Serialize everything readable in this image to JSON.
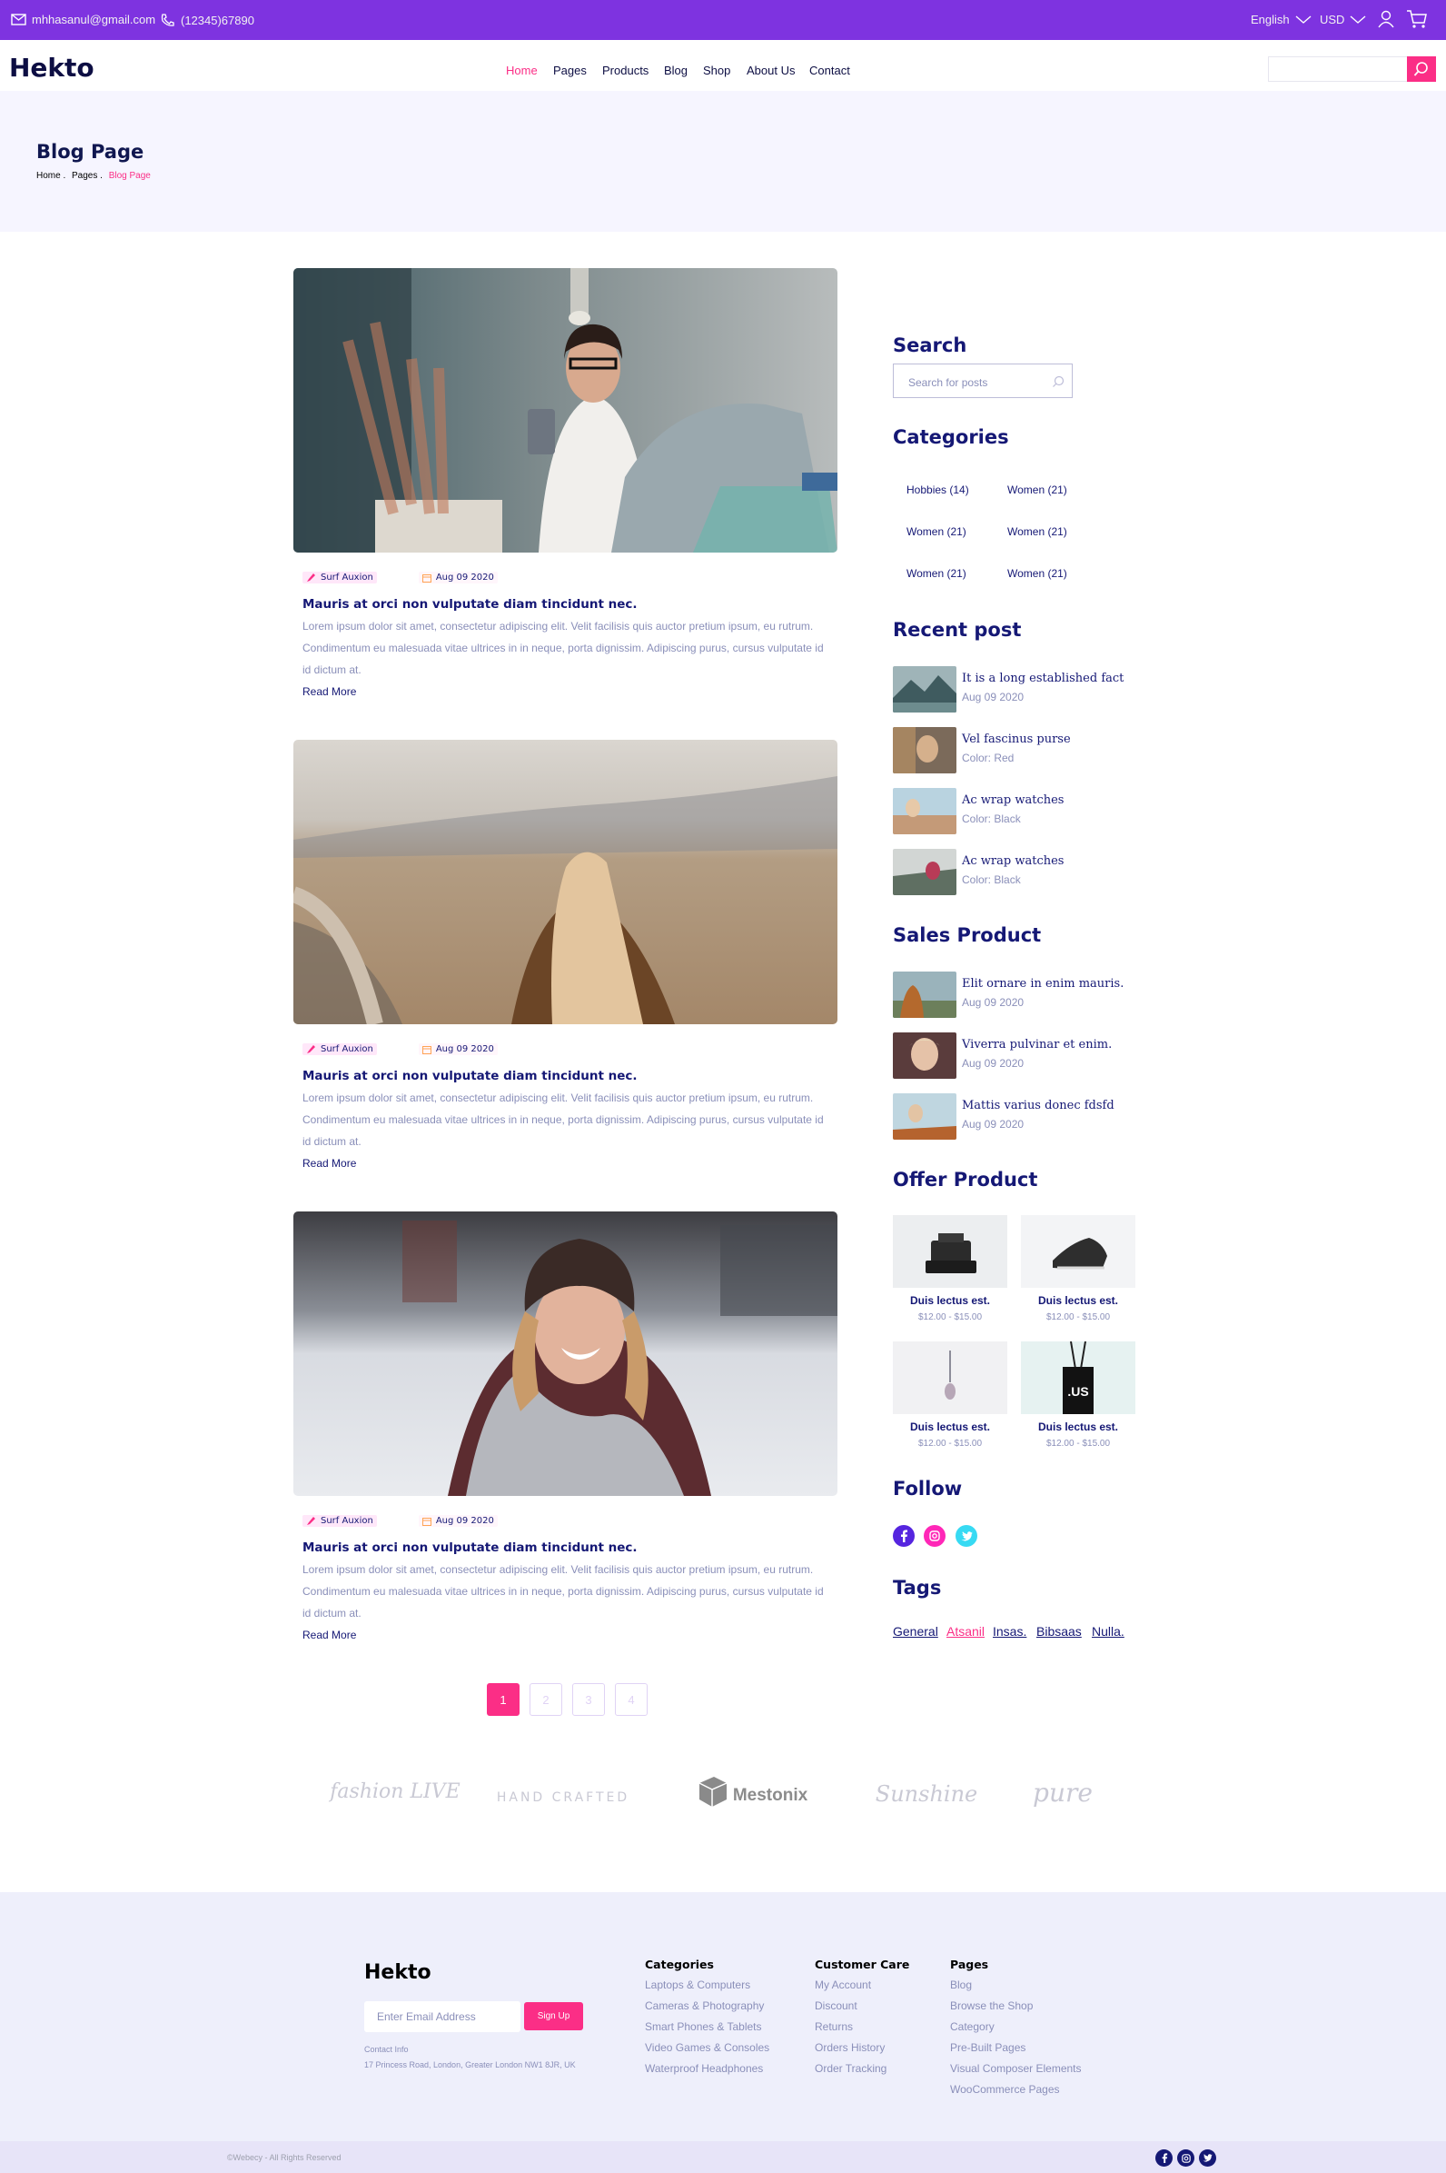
{
  "topbar": {
    "email": "mhhasanul@gmail.com",
    "phone": "(12345)67890",
    "language": "English",
    "currency": "USD"
  },
  "nav": {
    "logo": "Hekto",
    "items": [
      "Home",
      "Pages",
      "Products",
      "Blog",
      "Shop",
      "About Us",
      "Contact"
    ],
    "search_value": ""
  },
  "hero": {
    "title": "Blog Page",
    "crumbs": [
      "Home .",
      "Pages .",
      "Blog Page"
    ]
  },
  "posts": [
    {
      "author": "Surf Auxion",
      "date": "Aug 09 2020",
      "title": "Mauris at orci non vulputate diam tincidunt nec.",
      "line1": "Lorem ipsum dolor sit amet, consectetur adipiscing elit. Velit facilisis quis auctor pretium ipsum, eu rutrum.",
      "line2": "Condimentum eu malesuada vitae ultrices in in neque, porta dignissim. Adipiscing purus, cursus vulputate id",
      "line3": "id dictum at.",
      "read_more": "Read More"
    },
    {
      "author": "Surf Auxion",
      "date": "Aug 09 2020",
      "title": "Mauris at orci non vulputate diam tincidunt nec.",
      "line1": "Lorem ipsum dolor sit amet, consectetur adipiscing elit. Velit facilisis quis auctor pretium ipsum, eu rutrum.",
      "line2": "Condimentum eu malesuada vitae ultrices in in neque, porta dignissim. Adipiscing purus, cursus vulputate id",
      "line3": "id dictum at.",
      "read_more": "Read More"
    },
    {
      "author": "Surf Auxion",
      "date": "Aug 09 2020",
      "title": "Mauris at orci non vulputate diam tincidunt nec.",
      "line1": "Lorem ipsum dolor sit amet, consectetur adipiscing elit. Velit facilisis quis auctor pretium ipsum, eu rutrum.",
      "line2": "Condimentum eu malesuada vitae ultrices in in neque, porta dignissim. Adipiscing purus, cursus vulputate id",
      "line3": "id dictum at.",
      "read_more": "Read More"
    }
  ],
  "pagination": [
    "1",
    "2",
    "3",
    "4"
  ],
  "sidebar": {
    "search_title": "Search",
    "search_placeholder": "Search for posts",
    "categories_title": "Categories",
    "categories": [
      "Hobbies (14)",
      "Women (21)",
      "Women (21)",
      "Women (21)",
      "Women (21)",
      "Women (21)"
    ],
    "recent_title": "Recent post",
    "recent": [
      {
        "title": "It is a long established fact",
        "sub": "Aug 09 2020"
      },
      {
        "title": "Vel fascinus purse",
        "sub": "Color: Red"
      },
      {
        "title": "Ac wrap watches",
        "sub": "Color: Black"
      },
      {
        "title": "Ac wrap watches",
        "sub": "Color: Black"
      }
    ],
    "sales_title": "Sales Product",
    "sales": [
      {
        "title": "Elit ornare in enim mauris.",
        "sub": "Aug 09 2020"
      },
      {
        "title": "Viverra pulvinar et enim.",
        "sub": "Aug 09 2020"
      },
      {
        "title": "Mattis varius donec fdsfd",
        "sub": "Aug 09 2020"
      }
    ],
    "offer_title": "Offer Product",
    "offers": [
      {
        "name": "Duis lectus est.",
        "price": "$12.00 - $15.00"
      },
      {
        "name": "Duis lectus est.",
        "price": "$12.00 - $15.00"
      },
      {
        "name": "Duis lectus est.",
        "price": "$12.00 - $15.00"
      },
      {
        "name": "Duis lectus est.",
        "price": "$12.00 - $15.00"
      }
    ],
    "follow_title": "Follow",
    "tags_title": "Tags",
    "tags": [
      "General",
      "Atsanil",
      "Insas.",
      "Bibsaas",
      "Nulla."
    ]
  },
  "brands": [
    "fashion LIVE",
    "HAND CRAFTED",
    "Mestonix",
    "Sunshine",
    "pure"
  ],
  "footer": {
    "logo": "Hekto",
    "email_placeholder": "Enter Email Address",
    "signup": "Sign Up",
    "contact_label": "Contact Info",
    "address": "17 Princess Road, London, Greater London NW1 8JR, UK",
    "columns": [
      {
        "title": "Categories",
        "links": [
          "Laptops & Computers",
          "Cameras & Photography",
          "Smart Phones & Tablets",
          "Video Games & Consoles",
          "Waterproof Headphones"
        ]
      },
      {
        "title": "Customer Care",
        "links": [
          "My Account",
          "Discount",
          "Returns",
          "Orders History",
          "Order Tracking"
        ]
      },
      {
        "title": "Pages",
        "links": [
          "Blog",
          "Browse the Shop",
          "Category",
          "Pre-Built Pages",
          "Visual Composer Elements",
          "WooCommerce Pages"
        ]
      }
    ],
    "copyright": "©Webecy - All Rights Reserved"
  },
  "colors": {
    "topbar": "#7e33e0",
    "accent": "#fb2e86",
    "navy": "#151875",
    "muted": "#8a8fb9"
  }
}
